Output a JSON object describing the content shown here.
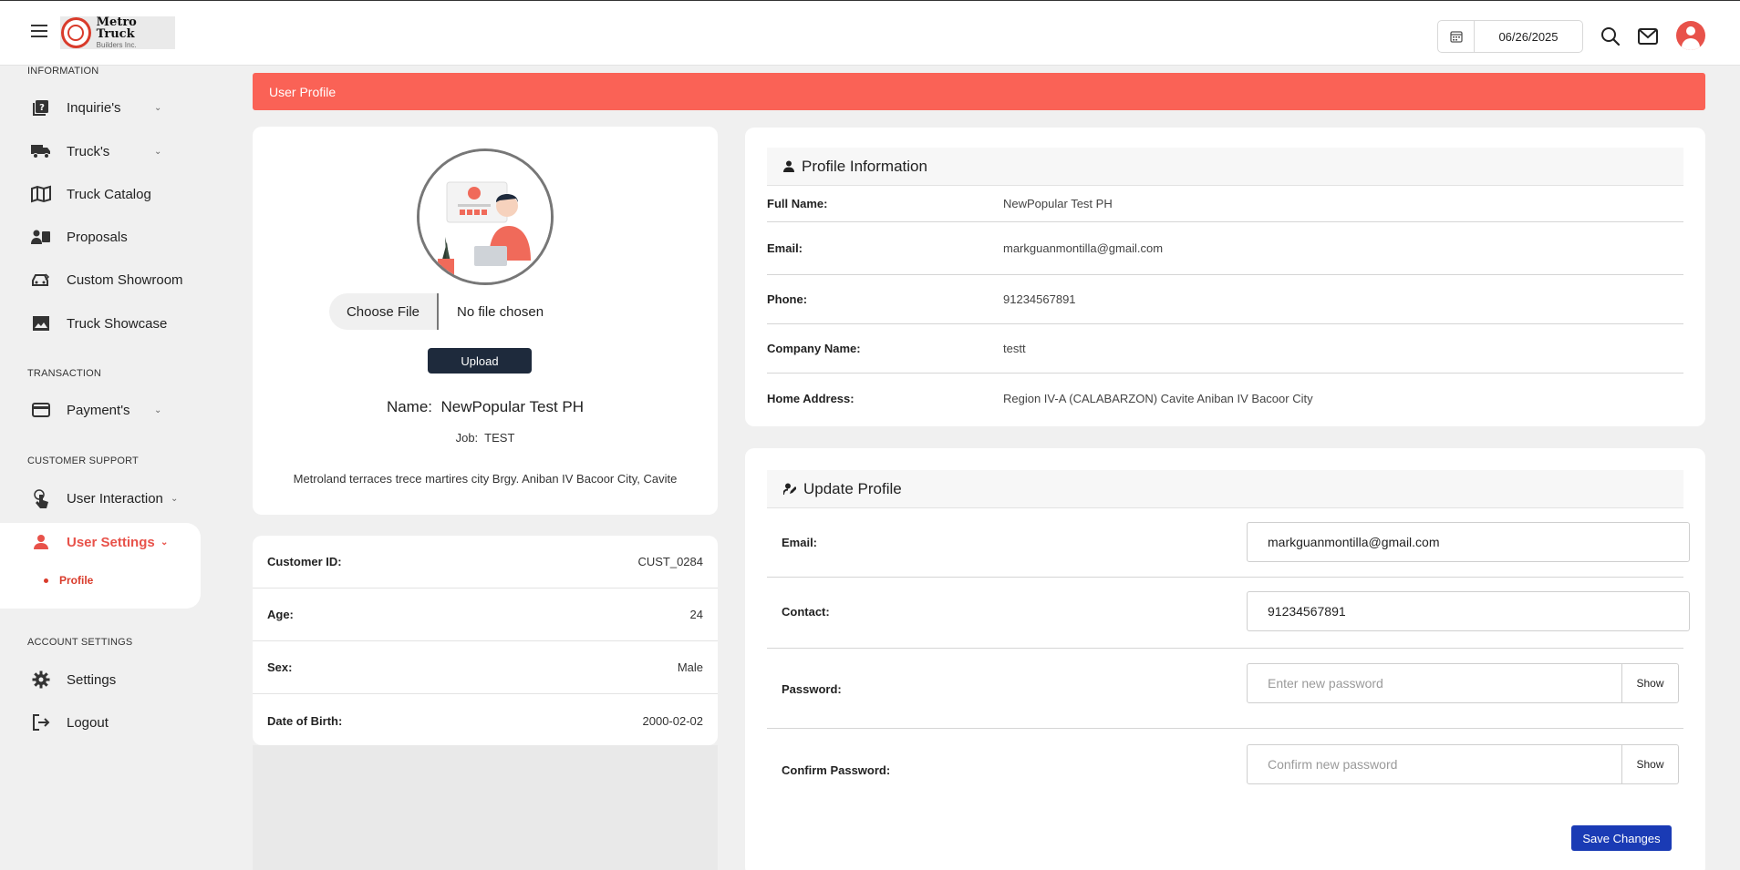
{
  "header": {
    "brand_title": "Metro Truck",
    "brand_subtitle": "Builders Inc.",
    "date": "06/26/2025"
  },
  "sidebar": {
    "sections": {
      "information": "INFORMATION",
      "transaction": "TRANSACTION",
      "customer_support": "CUSTOMER SUPPORT",
      "account_settings": "ACCOUNT SETTINGS"
    },
    "items": {
      "inquiries": "Inquirie's",
      "trucks": "Truck's",
      "truck_catalog": "Truck Catalog",
      "proposals": "Proposals",
      "custom_showroom": "Custom Showroom",
      "truck_showcase": "Truck Showcase",
      "payments": "Payment's",
      "user_interaction": "User Interaction",
      "user_settings": "User Settings",
      "profile": "Profile",
      "settings": "Settings",
      "logout": "Logout"
    },
    "accent_color": "#e8524a"
  },
  "banner": {
    "title": "User Profile",
    "color": "#fa6256"
  },
  "profile_card": {
    "choose_file_label": "Choose File",
    "no_file_label": "No file chosen",
    "upload_label": "Upload",
    "name_label": "Name:",
    "name_value": "NewPopular Test PH",
    "job_label": "Job:",
    "job_value": "TEST",
    "address": "Metroland terraces trece martires city Brgy. Aniban IV Bacoor City, Cavite"
  },
  "details": [
    {
      "label": "Customer ID:",
      "value": "CUST_0284"
    },
    {
      "label": "Age:",
      "value": "24"
    },
    {
      "label": "Sex:",
      "value": "Male"
    },
    {
      "label": "Date of Birth:",
      "value": "2000-02-02"
    }
  ],
  "profile_information": {
    "title": "Profile Information",
    "rows": [
      {
        "label": "Full Name:",
        "value": "NewPopular Test PH"
      },
      {
        "label": "Email:",
        "value": "markguanmontilla@gmail.com"
      },
      {
        "label": "Phone:",
        "value": "91234567891"
      },
      {
        "label": "Company Name:",
        "value": "testt"
      },
      {
        "label": "Home Address:",
        "value": "Region IV-A (CALABARZON) Cavite Aniban IV Bacoor City"
      }
    ]
  },
  "update_profile": {
    "title": "Update Profile",
    "email_label": "Email:",
    "email_value": "markguanmontilla@gmail.com",
    "contact_label": "Contact:",
    "contact_value": "91234567891",
    "password_label": "Password:",
    "password_placeholder": "Enter new password",
    "confirm_label": "Confirm Password:",
    "confirm_placeholder": "Confirm new password",
    "show_label": "Show",
    "save_label": "Save Changes",
    "save_color": "#1a3bb5"
  }
}
